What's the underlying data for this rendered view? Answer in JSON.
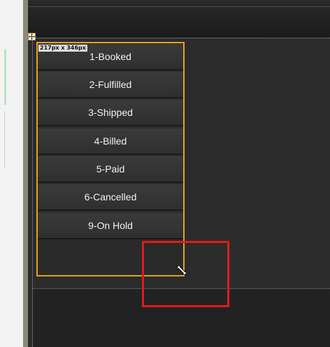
{
  "selection": {
    "size_label": "217px x 346px"
  },
  "menu": {
    "items": [
      {
        "label": "1-Booked"
      },
      {
        "label": "2-Fulfilled"
      },
      {
        "label": "3-Shipped"
      },
      {
        "label": "4-Billed"
      },
      {
        "label": "5-Paid"
      },
      {
        "label": "6-Cancelled"
      },
      {
        "label": "9-On Hold"
      }
    ]
  },
  "icons": {
    "move": "move-icon",
    "resize": "resize-diagonal-icon"
  },
  "colors": {
    "selection_border": "#e8a21a",
    "highlight_border": "#e01b1b",
    "canvas_bg": "#2b2b2b",
    "item_text": "#f2f2f2"
  }
}
